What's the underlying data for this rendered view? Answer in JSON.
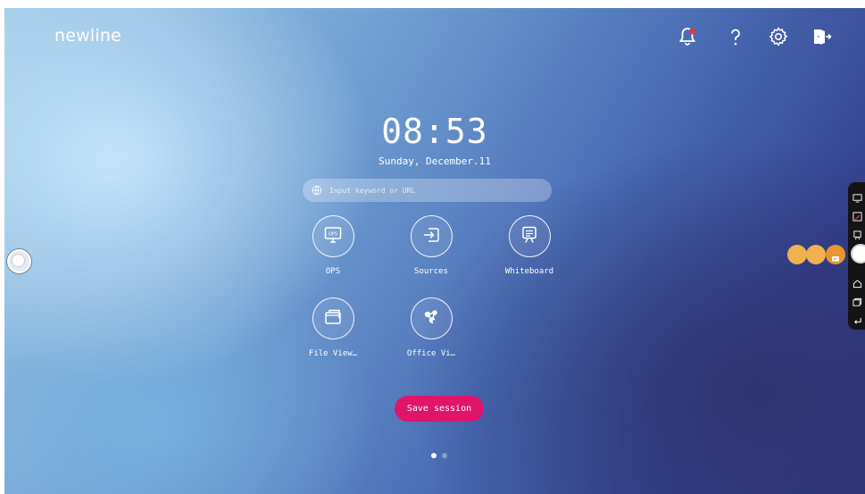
{
  "brand": {
    "logo": "newline"
  },
  "topbar": {
    "icons": [
      "notification-bell-icon",
      "help-icon",
      "settings-gear-icon",
      "exit-door-icon"
    ],
    "notification_dot_color": "#e53935"
  },
  "clock": {
    "time": "08:53",
    "date": "Sunday, December.11"
  },
  "search": {
    "placeholder": "Input keyword or URL",
    "icon": "globe-icon"
  },
  "apps": [
    {
      "label": "OPS",
      "icon": "ops-icon"
    },
    {
      "label": "Sources",
      "icon": "input-source-icon"
    },
    {
      "label": "Whiteboard",
      "icon": "whiteboard-icon"
    },
    {
      "label": "File View…",
      "icon": "folder-icon"
    },
    {
      "label": "Office Vi…",
      "icon": "office-viewer-icon"
    }
  ],
  "actions": {
    "save_session": "Save session"
  },
  "pagination": {
    "current_page": 1,
    "total_pages": 2
  },
  "side_toolbar": {
    "icons": [
      "screen-icon",
      "annotate-icon",
      "whiteboard-small-icon",
      "home-icon",
      "windows-icon",
      "back-icon"
    ]
  },
  "colors": {
    "accent": "#e0156a",
    "orange": "#f0b14e"
  }
}
